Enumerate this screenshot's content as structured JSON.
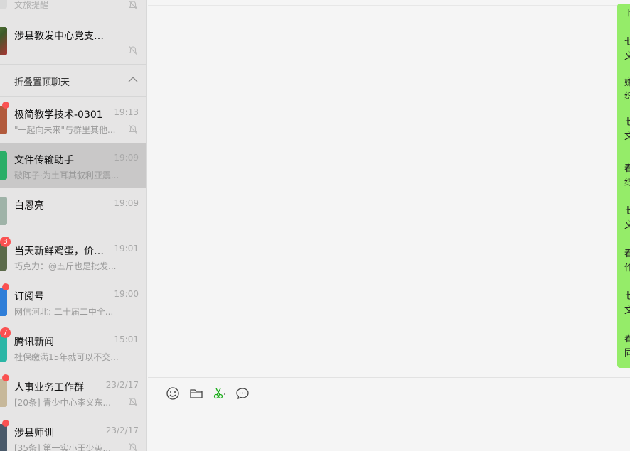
{
  "sidebar": {
    "partial_top_label": "文旅提醒",
    "top_item": {
      "name": "涉县教发中心党支部群"
    },
    "fold": {
      "label": "折叠置顶聊天"
    },
    "items": [
      {
        "name": "极简教学技术-0301",
        "time": "19:13",
        "preview": "\"一起向未来\"与群里其他...",
        "badge": "dot",
        "muted": true,
        "avatar_color": "#b25a3c"
      },
      {
        "name": "文件传输助手",
        "time": "19:09",
        "preview": "破阵子·为土耳其叙利亚震...",
        "badge": "",
        "muted": false,
        "avatar_color": "#2aae67",
        "selected": true
      },
      {
        "name": "白恩亮",
        "time": "19:09",
        "preview": "",
        "badge": "",
        "muted": false,
        "avatar_color": "#9fb3a8"
      },
      {
        "name": "当天新鲜鸡蛋，价格...",
        "time": "19:01",
        "preview": "巧克力：@五斤也是批发...",
        "badge": "3",
        "muted": false,
        "avatar_color": "#5b6a4a"
      },
      {
        "name": "订阅号",
        "time": "19:00",
        "preview": "网信河北: 二十届二中全...",
        "badge": "dot",
        "muted": false,
        "avatar_color": "#2f7ed8"
      },
      {
        "name": "腾讯新闻",
        "time": "15:01",
        "preview": "社保缴满15年就可以不交...",
        "badge": "7",
        "muted": false,
        "avatar_color": "#2bb6a6"
      },
      {
        "name": "人事业务工作群",
        "time": "23/2/17",
        "preview": "[20条] 青少中心李义东...",
        "badge": "dot",
        "muted": true,
        "avatar_color": "#c7b89a"
      },
      {
        "name": "涉县师训",
        "time": "23/2/17",
        "preview": "[35条] 第一实小王少英...",
        "badge": "dot",
        "muted": true,
        "avatar_color": "#4a5a6a"
      }
    ]
  },
  "message": {
    "fragments": [
      "下",
      "七",
      "文",
      "嫌",
      "绵",
      "七",
      "文",
      "春",
      "结",
      "七",
      "文",
      "春",
      "作",
      "七",
      "文",
      "春",
      "同"
    ]
  },
  "toolbar": {
    "icons": [
      "emoji-icon",
      "folder-icon",
      "scissors-icon",
      "chat-history-icon"
    ]
  }
}
